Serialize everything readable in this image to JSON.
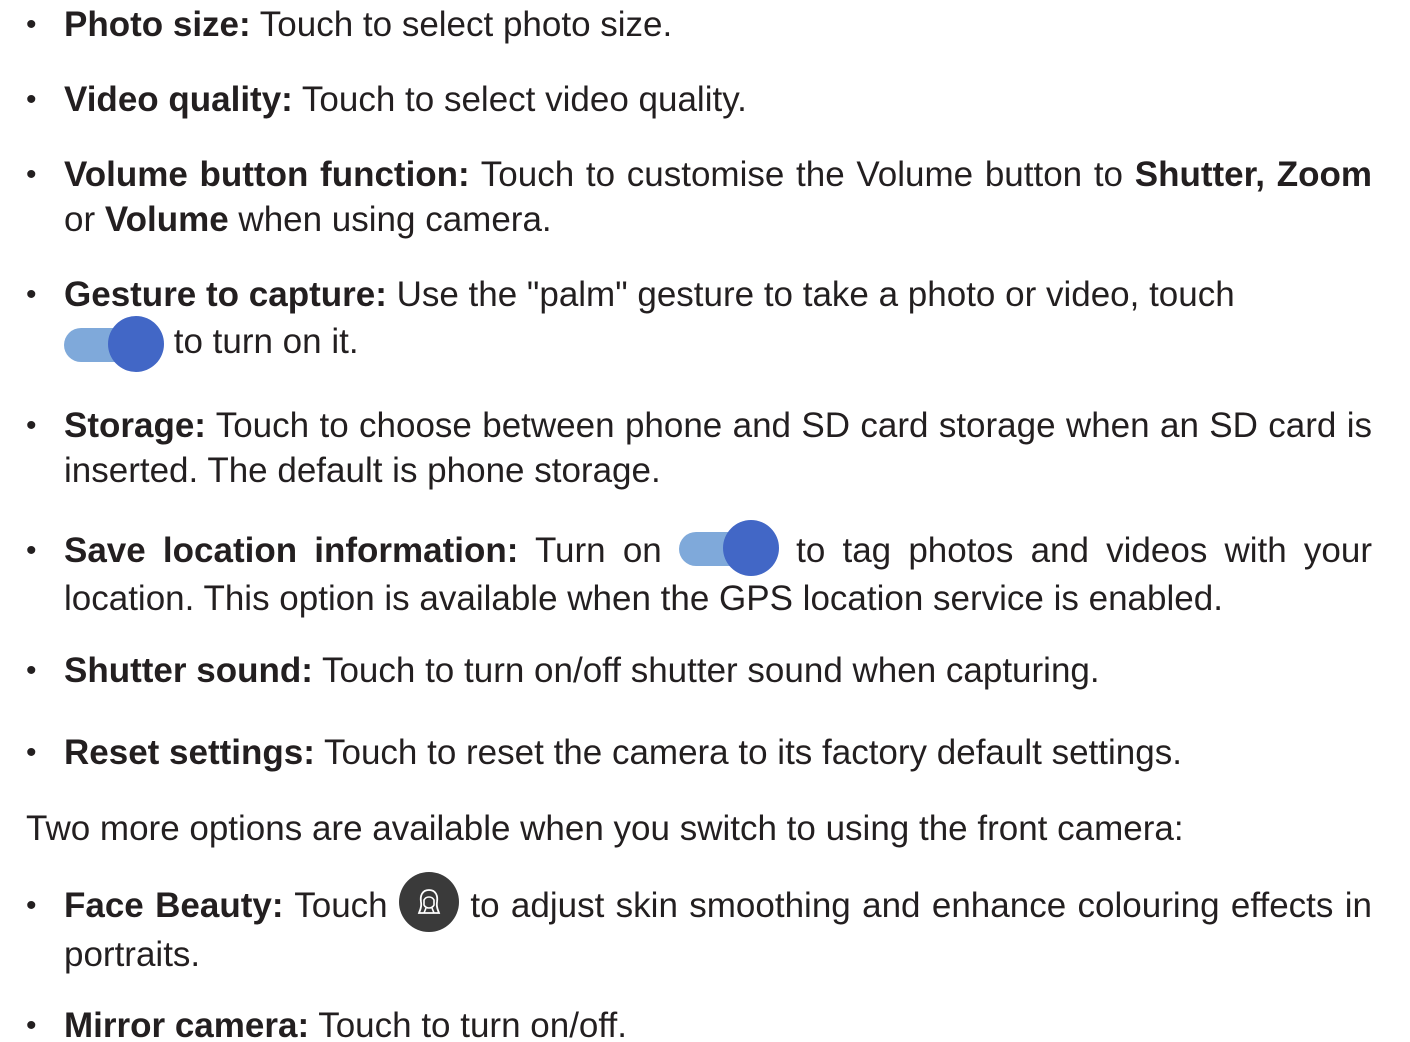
{
  "items": [
    {
      "label": "Photo size:",
      "text": " Touch to select photo size."
    },
    {
      "label": "Video quality:",
      "text": " Touch to select video quality."
    },
    {
      "label": "Volume button function:",
      "text1": " Touch to customise the Volume button to ",
      "bold1": "Shutter,",
      "bold2": "Zoom",
      "text2": " or ",
      "bold3": "Volume",
      "text3": " when using camera."
    },
    {
      "label": "Gesture to capture:",
      "text1": " Use the \"palm\" gesture to take a photo or video, touch",
      "text2": " to turn on it."
    },
    {
      "label": "Storage:",
      "text": " Touch to choose between phone and SD card storage when an SD card is inserted. The default is phone storage."
    },
    {
      "label": "Save location information:",
      "text1": " Turn on ",
      "text2": " to tag photos and videos with your location. This option is available when the GPS location service is enabled."
    },
    {
      "label": "Shutter sound:",
      "text": " Touch to turn on/off shutter sound when capturing."
    },
    {
      "label": "Reset settings:",
      "text": " Touch to reset the camera to its factory default settings."
    }
  ],
  "intro": "Two more options are available when you switch to using the front camera:",
  "front_items": [
    {
      "label": "Face Beauty:",
      "text1": " Touch ",
      "text2": " to adjust skin smoothing and enhance colouring effects in portraits."
    },
    {
      "label": "Mirror camera:",
      "text": " Touch to turn on/off."
    }
  ],
  "icons": {
    "toggle": "toggle-switch-on-icon",
    "face_beauty": "face-beauty-icon"
  },
  "colors": {
    "toggle_track": "#7fa9da",
    "toggle_knob": "#4267c6",
    "face_icon_bg": "#3a3a3a"
  }
}
